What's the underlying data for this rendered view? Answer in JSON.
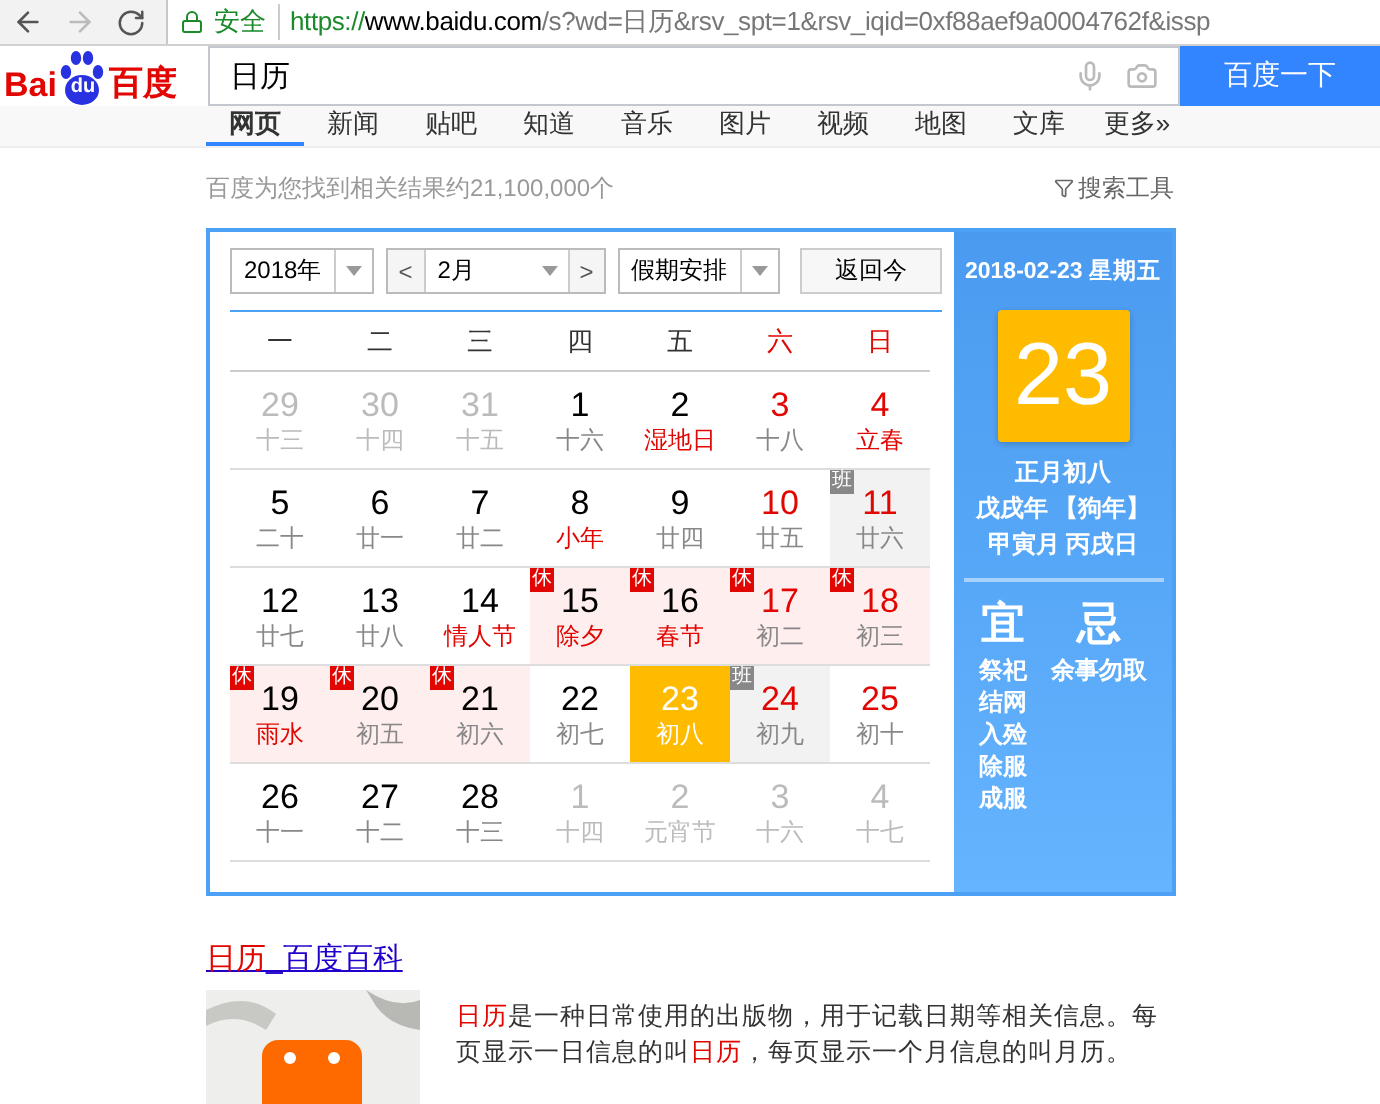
{
  "browser": {
    "secure_label": "安全",
    "url_scheme": "https://",
    "url_host": "www.baidu.com",
    "url_path": "/s?wd=日历&rsv_spt=1&rsv_iqid=0xf88aef9a0004762f&issp"
  },
  "logo": {
    "left": "Bai",
    "paw": "du",
    "right": "百度"
  },
  "search": {
    "value": "日历",
    "button": "百度一下"
  },
  "tabs": [
    {
      "label": "网页",
      "selected": true
    },
    {
      "label": "新闻",
      "selected": false
    },
    {
      "label": "贴吧",
      "selected": false
    },
    {
      "label": "知道",
      "selected": false
    },
    {
      "label": "音乐",
      "selected": false
    },
    {
      "label": "图片",
      "selected": false
    },
    {
      "label": "视频",
      "selected": false
    },
    {
      "label": "地图",
      "selected": false
    },
    {
      "label": "文库",
      "selected": false
    },
    {
      "label": "更多»",
      "selected": false
    }
  ],
  "result_count": "百度为您找到相关结果约21,100,000个",
  "search_tools": "搜索工具",
  "calendar": {
    "year": "2018年",
    "prev": "<",
    "month": "2月",
    "next": ">",
    "holiday": "假期安排",
    "today_button": "返回今",
    "weekdays": [
      {
        "label": "一",
        "weekend": false
      },
      {
        "label": "二",
        "weekend": false
      },
      {
        "label": "三",
        "weekend": false
      },
      {
        "label": "四",
        "weekend": false
      },
      {
        "label": "五",
        "weekend": false
      },
      {
        "label": "六",
        "weekend": true
      },
      {
        "label": "日",
        "weekend": true
      }
    ],
    "weeks": [
      [
        {
          "day": "29",
          "lunar": "十三",
          "other_month": true,
          "weekend": false,
          "festival": false,
          "selected": false
        },
        {
          "day": "30",
          "lunar": "十四",
          "other_month": true,
          "weekend": false,
          "festival": false,
          "selected": false
        },
        {
          "day": "31",
          "lunar": "十五",
          "other_month": true,
          "weekend": false,
          "festival": false,
          "selected": false
        },
        {
          "day": "1",
          "lunar": "十六",
          "other_month": false,
          "weekend": false,
          "festival": false,
          "selected": false
        },
        {
          "day": "2",
          "lunar": "湿地日",
          "other_month": false,
          "weekend": false,
          "festival": true,
          "selected": false
        },
        {
          "day": "3",
          "lunar": "十八",
          "other_month": false,
          "weekend": true,
          "festival": false,
          "selected": false
        },
        {
          "day": "4",
          "lunar": "立春",
          "other_month": false,
          "weekend": true,
          "festival": true,
          "selected": false
        }
      ],
      [
        {
          "day": "5",
          "lunar": "二十",
          "other_month": false,
          "weekend": false,
          "festival": false,
          "selected": false
        },
        {
          "day": "6",
          "lunar": "廿一",
          "other_month": false,
          "weekend": false,
          "festival": false,
          "selected": false
        },
        {
          "day": "7",
          "lunar": "廿二",
          "other_month": false,
          "weekend": false,
          "festival": false,
          "selected": false
        },
        {
          "day": "8",
          "lunar": "小年",
          "other_month": false,
          "weekend": false,
          "festival": true,
          "selected": false
        },
        {
          "day": "9",
          "lunar": "廿四",
          "other_month": false,
          "weekend": false,
          "festival": false,
          "selected": false
        },
        {
          "day": "10",
          "lunar": "廿五",
          "other_month": false,
          "weekend": true,
          "festival": false,
          "selected": false
        },
        {
          "day": "11",
          "lunar": "廿六",
          "other_month": false,
          "weekend": true,
          "festival": false,
          "selected": false,
          "kind": "work",
          "badge": "班"
        }
      ],
      [
        {
          "day": "12",
          "lunar": "廿七",
          "other_month": false,
          "weekend": false,
          "festival": false,
          "selected": false
        },
        {
          "day": "13",
          "lunar": "廿八",
          "other_month": false,
          "weekend": false,
          "festival": false,
          "selected": false
        },
        {
          "day": "14",
          "lunar": "情人节",
          "other_month": false,
          "weekend": false,
          "festival": true,
          "selected": false
        },
        {
          "day": "15",
          "lunar": "除夕",
          "other_month": false,
          "weekend": false,
          "festival": true,
          "selected": false,
          "kind": "rest",
          "badge": "休"
        },
        {
          "day": "16",
          "lunar": "春节",
          "other_month": false,
          "weekend": false,
          "festival": true,
          "selected": false,
          "kind": "rest",
          "badge": "休"
        },
        {
          "day": "17",
          "lunar": "初二",
          "other_month": false,
          "weekend": true,
          "festival": false,
          "selected": false,
          "kind": "rest",
          "badge": "休"
        },
        {
          "day": "18",
          "lunar": "初三",
          "other_month": false,
          "weekend": true,
          "festival": false,
          "selected": false,
          "kind": "rest",
          "badge": "休"
        }
      ],
      [
        {
          "day": "19",
          "lunar": "雨水",
          "other_month": false,
          "weekend": false,
          "festival": true,
          "selected": false,
          "kind": "rest",
          "badge": "休"
        },
        {
          "day": "20",
          "lunar": "初五",
          "other_month": false,
          "weekend": false,
          "festival": false,
          "selected": false,
          "kind": "rest",
          "badge": "休"
        },
        {
          "day": "21",
          "lunar": "初六",
          "other_month": false,
          "weekend": false,
          "festival": false,
          "selected": false,
          "kind": "rest",
          "badge": "休"
        },
        {
          "day": "22",
          "lunar": "初七",
          "other_month": false,
          "weekend": false,
          "festival": false,
          "selected": false
        },
        {
          "day": "23",
          "lunar": "初八",
          "other_month": false,
          "weekend": false,
          "festival": false,
          "selected": true
        },
        {
          "day": "24",
          "lunar": "初九",
          "other_month": false,
          "weekend": true,
          "festival": false,
          "selected": false,
          "kind": "work",
          "badge": "班"
        },
        {
          "day": "25",
          "lunar": "初十",
          "other_month": false,
          "weekend": true,
          "festival": false,
          "selected": false
        }
      ],
      [
        {
          "day": "26",
          "lunar": "十一",
          "other_month": false,
          "weekend": false,
          "festival": false,
          "selected": false
        },
        {
          "day": "27",
          "lunar": "十二",
          "other_month": false,
          "weekend": false,
          "festival": false,
          "selected": false
        },
        {
          "day": "28",
          "lunar": "十三",
          "other_month": false,
          "weekend": false,
          "festival": false,
          "selected": false
        },
        {
          "day": "1",
          "lunar": "十四",
          "other_month": true,
          "weekend": false,
          "festival": false,
          "selected": false
        },
        {
          "day": "2",
          "lunar": "元宵节",
          "other_month": true,
          "weekend": false,
          "festival": false,
          "selected": false
        },
        {
          "day": "3",
          "lunar": "十六",
          "other_month": true,
          "weekend": false,
          "festival": false,
          "selected": false
        },
        {
          "day": "4",
          "lunar": "十七",
          "other_month": true,
          "weekend": false,
          "festival": false,
          "selected": false
        }
      ]
    ]
  },
  "detail": {
    "date": "2018-02-23 星期五",
    "day": "23",
    "lunar_lines": [
      "正月初八",
      "戊戌年 【狗年】",
      "甲寅月 丙戌日"
    ],
    "good_label": "宜",
    "good": [
      "祭祀",
      "结网",
      "入殓",
      "除服",
      "成服"
    ],
    "bad_label": "忌",
    "bad": [
      "余事勿取"
    ]
  },
  "result": {
    "title": [
      {
        "text": "日历",
        "highlight": true
      },
      {
        "text": "_百度百科",
        "highlight": false
      }
    ],
    "snippet": [
      {
        "text": "日历",
        "highlight": true
      },
      {
        "text": "是一种日常使用的出版物，用于记载日期等相关信息。每页显示一日信息的叫",
        "highlight": false
      },
      {
        "text": "日历",
        "highlight": true
      },
      {
        "text": "，每页显示一个月信息的叫月历。",
        "highlight": false
      }
    ]
  }
}
